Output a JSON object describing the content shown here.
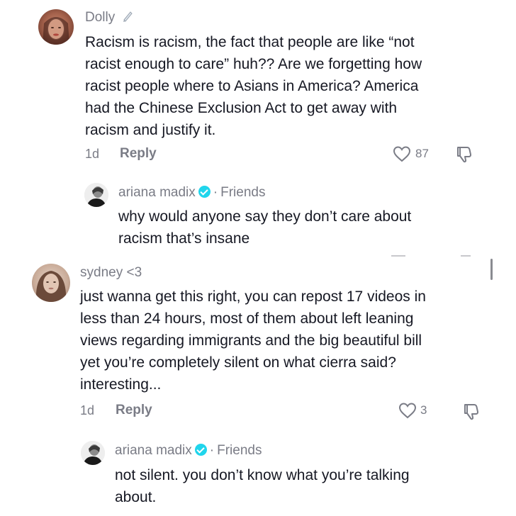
{
  "comments": [
    {
      "username": "Dolly",
      "body_lines": [
        "Racism is racism, the fact that people are like “not",
        "racist enough to care” huh?? Are we forgetting how",
        "racist people where to Asians in America? America",
        "had the Chinese Exclusion Act to get away with",
        "racism and justify it."
      ],
      "time": "1d",
      "reply_label": "Reply",
      "likes": "87",
      "reply": {
        "username": "ariana madix",
        "tag": "Friends",
        "separator": "·",
        "body_lines": [
          "why would anyone say they don’t care about",
          "racism that’s insane"
        ]
      }
    },
    {
      "username": "sydney <3",
      "body_lines": [
        "just wanna get this right, you can repost 17 videos in",
        "less than 24 hours, most of them about left leaning",
        "views regarding immigrants and the big beautiful bill",
        "yet you’re completely silent on what cierra said?",
        "interesting..."
      ],
      "time": "1d",
      "reply_label": "Reply",
      "likes": "3",
      "reply": {
        "username": "ariana madix",
        "tag": "Friends",
        "separator": "·",
        "body_lines": [
          "not silent. you don’t know what you’re talking",
          "about."
        ]
      }
    }
  ],
  "icons": {
    "like": "heart-outline-icon",
    "dislike": "thumbs-down-icon",
    "verified": "verified-badge-icon",
    "edit_emoji": "pencil-icon"
  },
  "colors": {
    "text": "#161823",
    "muted": "#7a7c86",
    "verified": "#20d5ec"
  }
}
